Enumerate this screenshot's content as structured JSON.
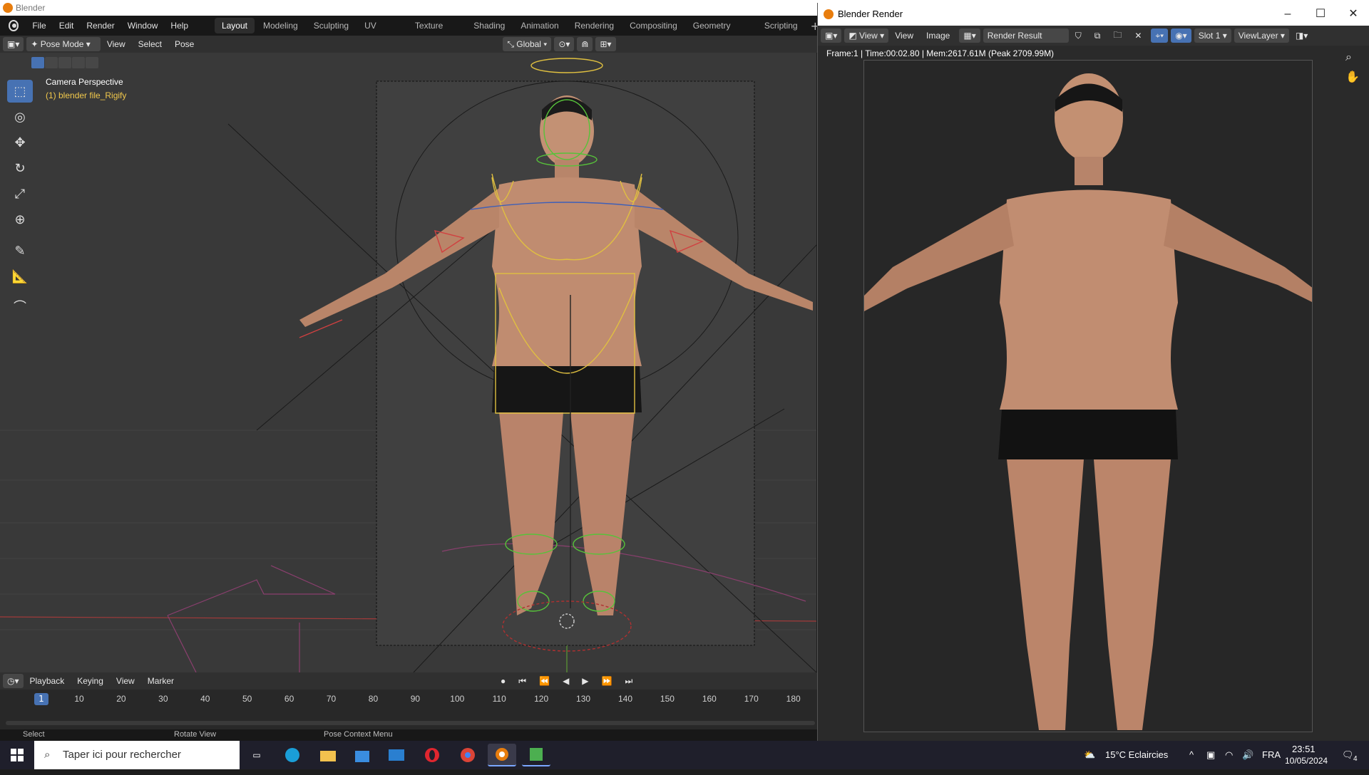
{
  "os": {
    "app_title": "Blender"
  },
  "menubar": {
    "menus": [
      "File",
      "Edit",
      "Render",
      "Window",
      "Help"
    ],
    "workspaces": [
      "Layout",
      "Modeling",
      "Sculpting",
      "UV Editing",
      "Texture Paint",
      "Shading",
      "Animation",
      "Rendering",
      "Compositing",
      "Geometry Nodes",
      "Scripting"
    ],
    "active_workspace": "Layout",
    "add_icon": "plus-icon"
  },
  "viewport_header": {
    "mode": "Pose Mode",
    "menus": [
      "View",
      "Select",
      "Pose"
    ],
    "transform_orientation": "Global"
  },
  "viewport": {
    "camera_label": "Camera Perspective",
    "object_label": "(1) blender file_Rigify",
    "tools": [
      "select-box-icon",
      "cursor-icon",
      "move-icon",
      "rotate-icon",
      "scale-icon",
      "transform-icon",
      "annotate-icon",
      "measure-icon",
      "bone-roll-icon"
    ]
  },
  "timeline": {
    "menus": [
      "Playback",
      "Keying",
      "View",
      "Marker"
    ],
    "current_frame": "1",
    "ticks": [
      "10",
      "20",
      "30",
      "40",
      "50",
      "60",
      "70",
      "80",
      "90",
      "100",
      "110",
      "120",
      "130",
      "140",
      "150",
      "160",
      "170",
      "180"
    ]
  },
  "statusbar": {
    "left": "Select",
    "middle": "Rotate View",
    "right": "Pose Context Menu"
  },
  "render_window": {
    "title": "Blender Render",
    "menus": [
      "View",
      "View",
      "Image"
    ],
    "image_name": "Render Result",
    "slot": "Slot 1",
    "view_layer": "ViewLayer",
    "info": "Frame:1 | Time:00:02.80 | Mem:2617.61M (Peak 2709.99M)"
  },
  "taskbar": {
    "search_placeholder": "Taper ici pour rechercher",
    "weather": "15°C  Eclaircies",
    "language": "FRA",
    "time": "23:51",
    "date": "10/05/2024",
    "notifications": "4"
  }
}
